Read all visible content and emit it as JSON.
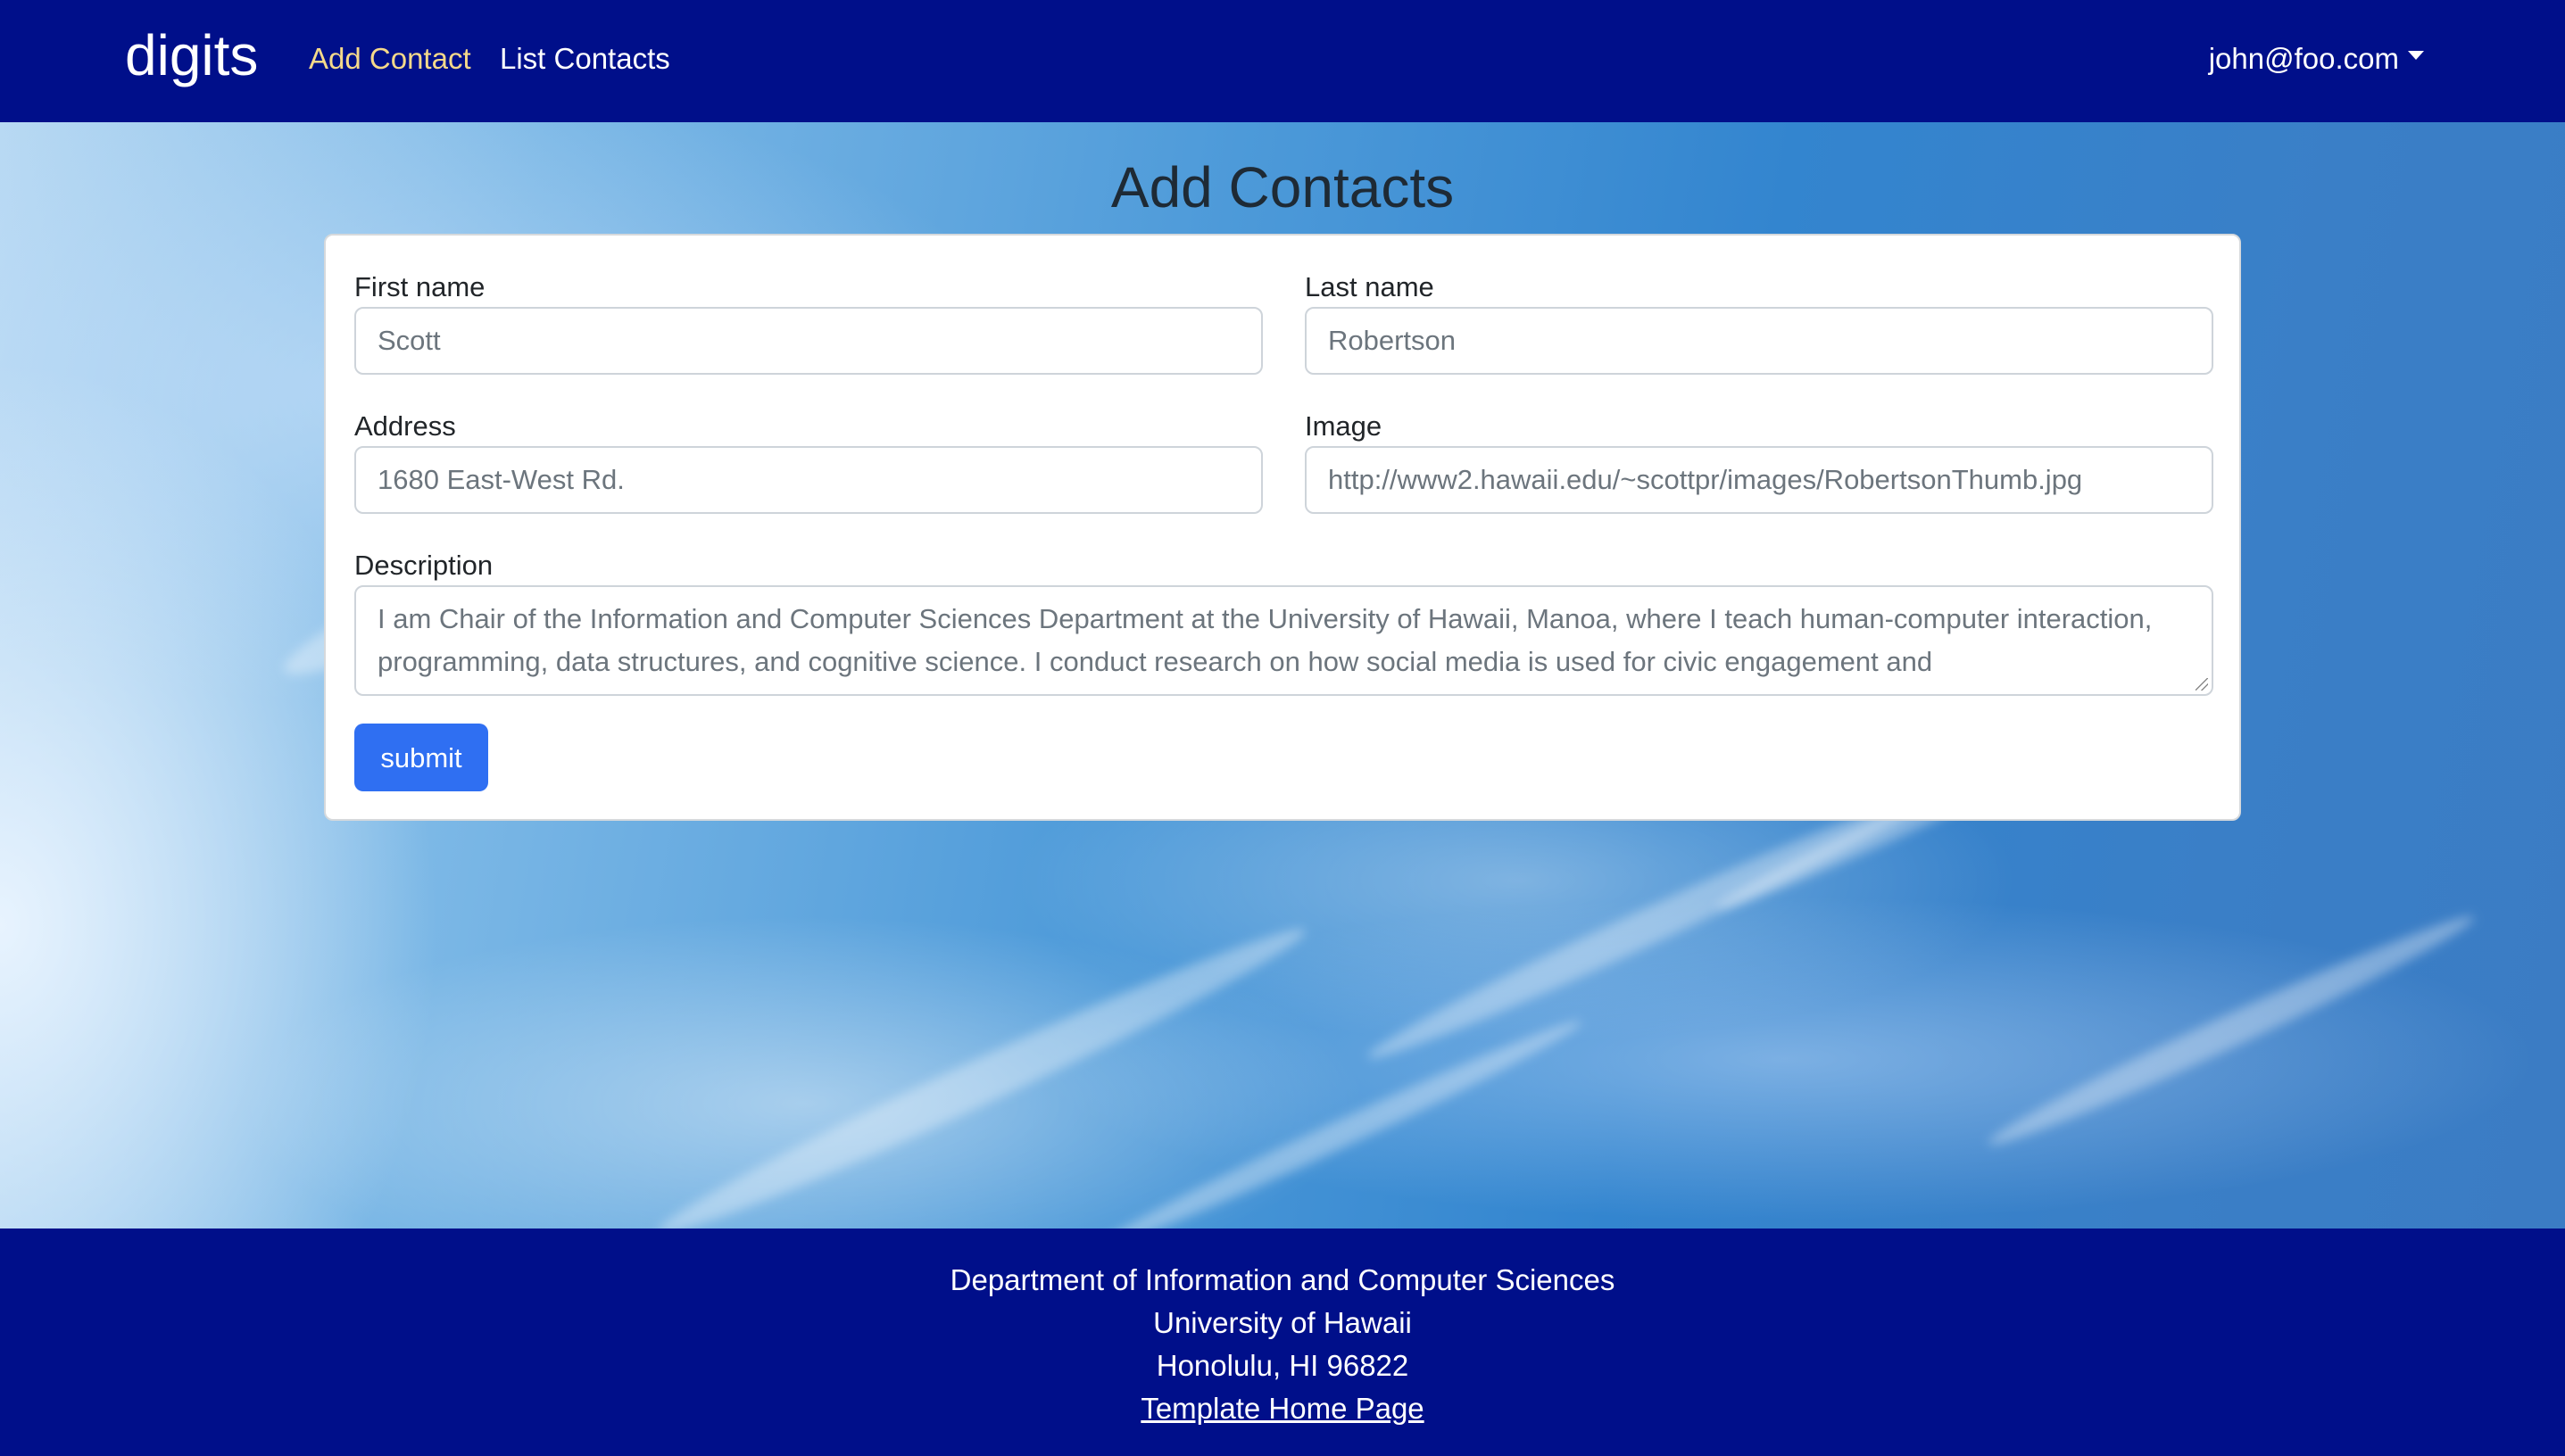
{
  "navbar": {
    "brand": "digits",
    "links": [
      {
        "label": "Add Contact",
        "active": true
      },
      {
        "label": "List Contacts",
        "active": false
      }
    ],
    "user": "john@foo.com"
  },
  "page": {
    "title": "Add Contacts"
  },
  "form": {
    "first_name": {
      "label": "First name",
      "value": "Scott"
    },
    "last_name": {
      "label": "Last name",
      "value": "Robertson"
    },
    "address": {
      "label": "Address",
      "value": "1680 East-West Rd."
    },
    "image": {
      "label": "Image",
      "value": "http://www2.hawaii.edu/~scottpr/images/RobertsonThumb.jpg"
    },
    "description": {
      "label": "Description",
      "value": "I am Chair of the Information and Computer Sciences Department at the University of Hawaii, Manoa, where I teach human-computer interaction, programming, data structures, and cognitive science. I conduct research on how social media is used for civic engagement and"
    },
    "submit_label": "submit"
  },
  "footer": {
    "line1": "Department of Information and Computer Sciences",
    "line2": "University of Hawaii",
    "line3": "Honolulu, HI 96822",
    "link": "Template Home Page"
  },
  "colors": {
    "navbar_bg": "#000f8a",
    "active_link": "#f5d98a",
    "submit_bg": "#2f6ff2"
  }
}
